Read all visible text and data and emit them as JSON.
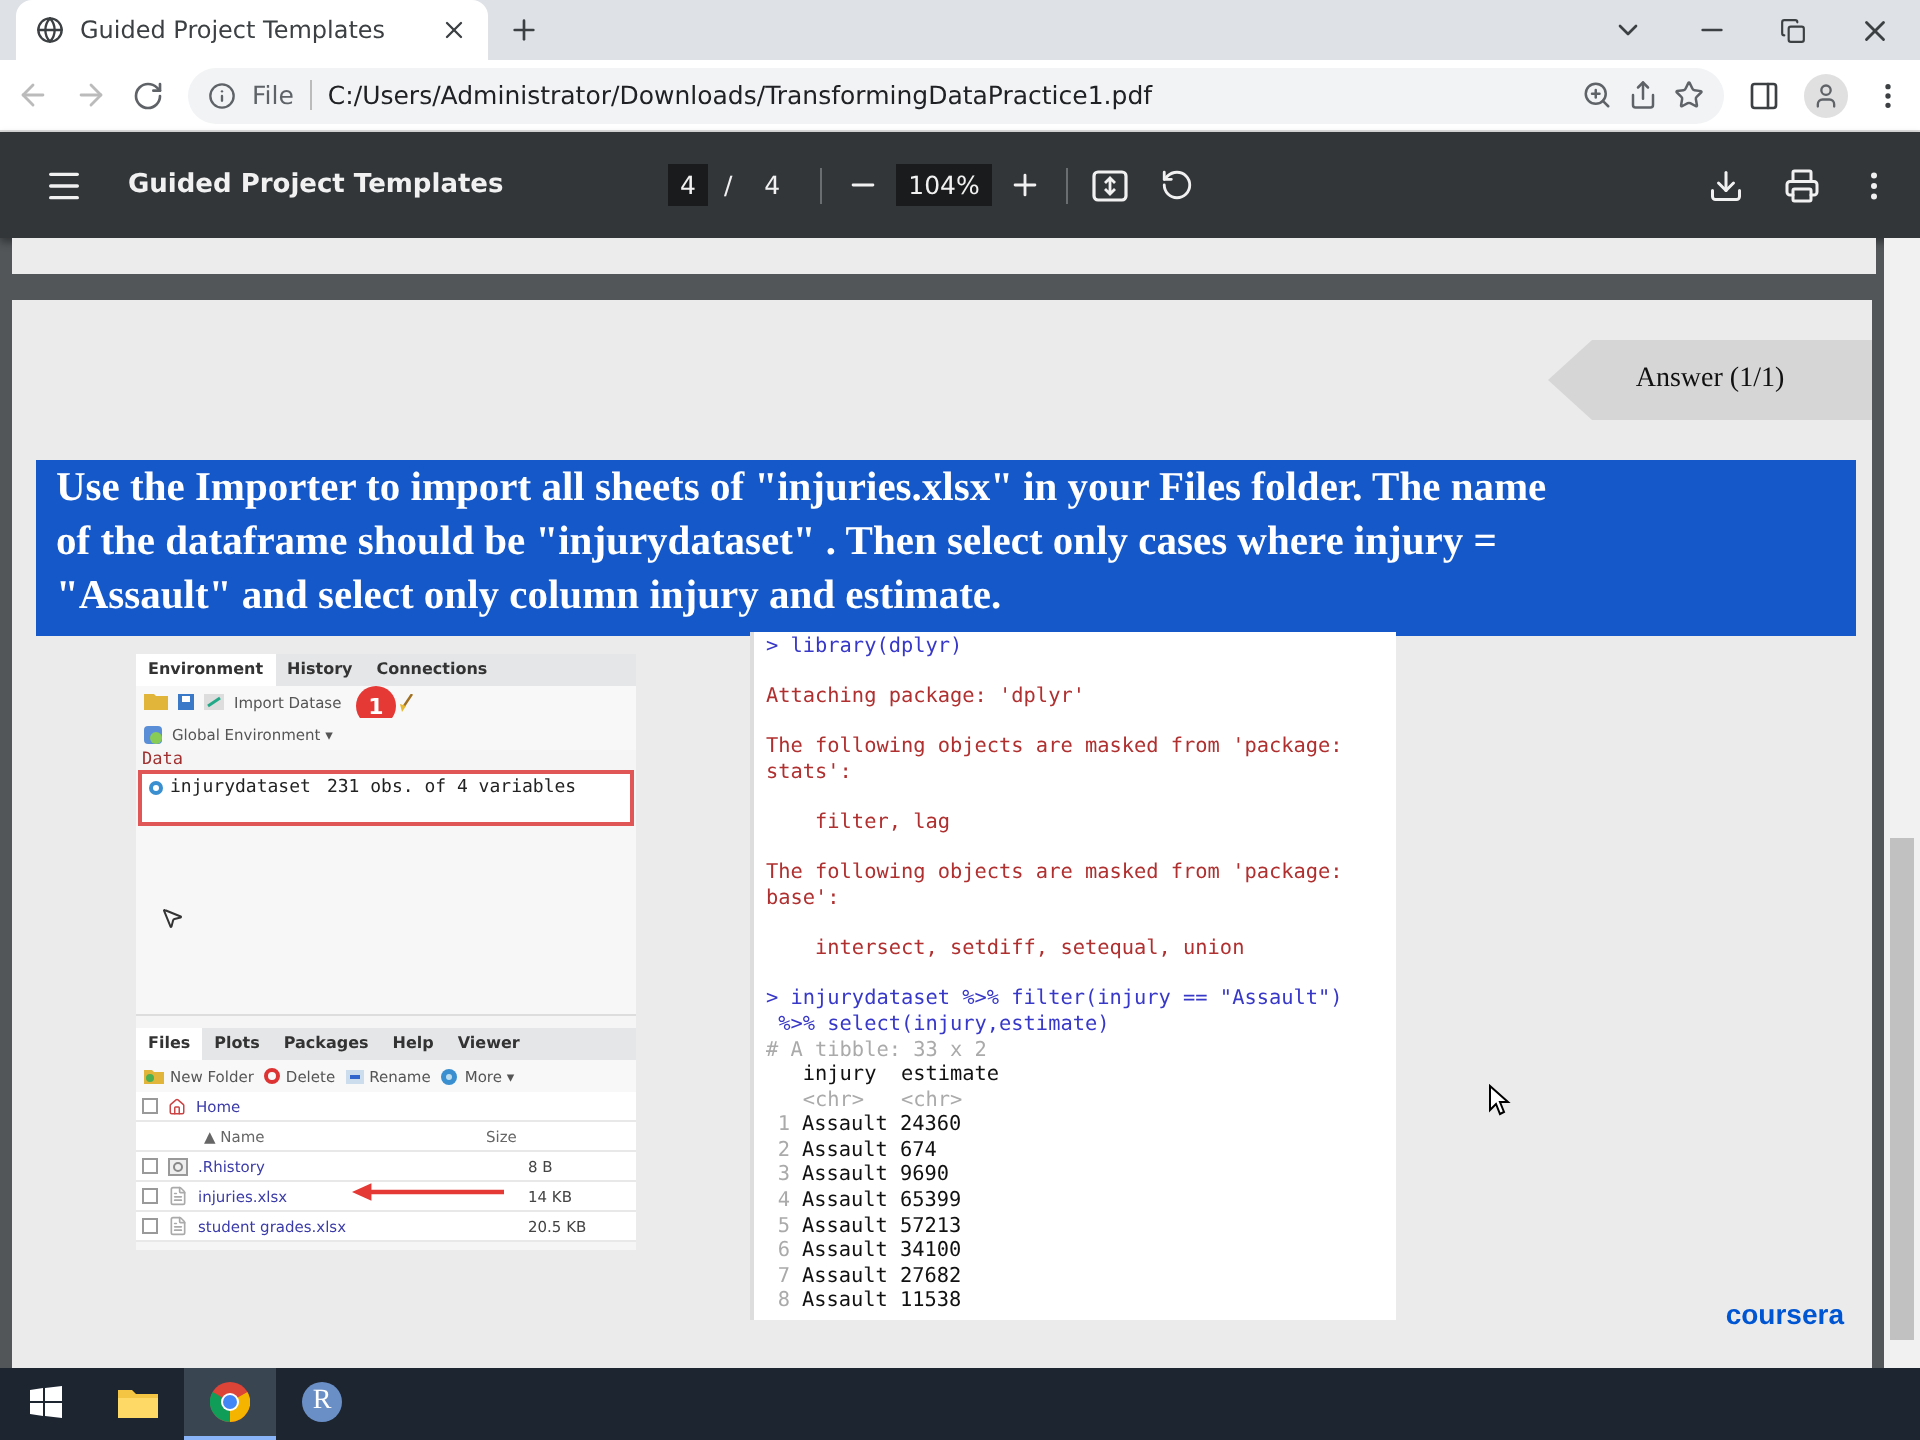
{
  "browser": {
    "tab_title": "Guided Project Templates",
    "url_scheme": "File",
    "url": "C:/Users/Administrator/Downloads/TransformingDataPractice1.pdf"
  },
  "pdf_toolbar": {
    "title": "Guided Project Templates",
    "page_current": "4",
    "page_separator": "/",
    "page_total": "4",
    "zoom": "104%"
  },
  "page": {
    "answer_tab": "Answer (1/1)",
    "prompt_lines": [
      "Use the Importer to import all sheets of \"injuries.xlsx\" in your Files folder. The name",
      "of the dataframe should be \"injurydataset\" . Then select only cases where injury =",
      "\"Assault\" and select only column injury and estimate."
    ],
    "environment_panel": {
      "tabs": [
        {
          "label": "Environment",
          "selected": true
        },
        {
          "label": "History",
          "selected": false
        },
        {
          "label": "Connections",
          "selected": false
        }
      ],
      "import_label": "Import Datase",
      "step_badge": "1",
      "scope": "Global Environment",
      "scope_caret": "▾",
      "section": "Data",
      "object_name": "injurydataset",
      "object_info": "231 obs. of 4 variables"
    },
    "files_panel": {
      "tabs": [
        {
          "label": "Files",
          "selected": true
        },
        {
          "label": "Plots",
          "selected": false
        },
        {
          "label": "Packages",
          "selected": false
        },
        {
          "label": "Help",
          "selected": false
        },
        {
          "label": "Viewer",
          "selected": false
        }
      ],
      "toolbar": [
        {
          "kind": "new-folder",
          "label": "New Folder"
        },
        {
          "kind": "delete",
          "label": "Delete"
        },
        {
          "kind": "rename",
          "label": "Rename"
        },
        {
          "kind": "more",
          "label": "More ▾"
        }
      ],
      "breadcrumb": "Home",
      "breadcrumb_checked": false,
      "columns": [
        {
          "label": "▲ Name"
        },
        {
          "label": "Size"
        }
      ],
      "rows": [
        {
          "kind": "history",
          "name": ".Rhistory",
          "size": "8 B",
          "checked": false
        },
        {
          "kind": "file",
          "name": "injuries.xlsx",
          "size": "14 KB",
          "checked": false
        },
        {
          "kind": "file",
          "name": "student grades.xlsx",
          "size": "20.5 KB",
          "checked": false
        }
      ]
    },
    "console": {
      "blocks": [
        [
          {
            "kind": "input",
            "text": "> library(dplyr)"
          }
        ],
        [
          {
            "kind": "message",
            "text": "Attaching package: 'dplyr'"
          }
        ],
        [
          {
            "kind": "message",
            "text": "The following objects are masked from 'package:"
          },
          {
            "kind": "message",
            "text": "stats':"
          }
        ],
        [
          {
            "kind": "message",
            "text": "    filter, lag"
          }
        ],
        [
          {
            "kind": "message",
            "text": "The following objects are masked from 'package:"
          },
          {
            "kind": "message",
            "text": "base':"
          }
        ],
        [
          {
            "kind": "message",
            "text": "    intersect, setdiff, setequal, union"
          }
        ],
        [
          {
            "kind": "input",
            "text": "> injurydataset %>% filter(injury == \"Assault\")"
          },
          {
            "kind": "input",
            "text": " %>% select(injury,estimate)"
          },
          {
            "kind": "dim",
            "text": "# A tibble: 33 x 2"
          },
          {
            "kind": "output",
            "text": "   injury  estimate"
          },
          {
            "kind": "dim",
            "text": "   <chr>   <chr>"
          }
        ]
      ],
      "rows": [
        {
          "index": "1",
          "injury": "Assault",
          "estimate": "24360"
        },
        {
          "index": "2",
          "injury": "Assault",
          "estimate": "674"
        },
        {
          "index": "3",
          "injury": "Assault",
          "estimate": "9690"
        },
        {
          "index": "4",
          "injury": "Assault",
          "estimate": "65399"
        },
        {
          "index": "5",
          "injury": "Assault",
          "estimate": "57213"
        },
        {
          "index": "6",
          "injury": "Assault",
          "estimate": "34100"
        },
        {
          "index": "7",
          "injury": "Assault",
          "estimate": "27682"
        },
        {
          "index": "8",
          "injury": "Assault",
          "estimate": "11538"
        }
      ]
    },
    "logo": "coursera"
  },
  "taskbar": [
    {
      "kind": "start",
      "selected": false
    },
    {
      "kind": "folder",
      "selected": false
    },
    {
      "kind": "chrome",
      "selected": true
    },
    {
      "kind": "r",
      "label": "R",
      "selected": false
    }
  ]
}
